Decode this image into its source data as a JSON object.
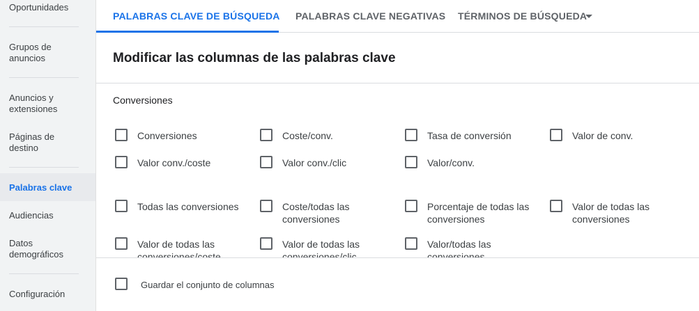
{
  "sidebar": {
    "items": [
      {
        "label": "Oportunidades"
      },
      {
        "label": "Grupos de anuncios"
      },
      {
        "label": "Anuncios y extensiones"
      },
      {
        "label": "Páginas de destino"
      },
      {
        "label": "Palabras clave"
      },
      {
        "label": "Audiencias"
      },
      {
        "label": "Datos demográficos"
      },
      {
        "label": "Configuración"
      }
    ],
    "active_item": "Palabras clave"
  },
  "tabs": [
    {
      "label": "PALABRAS CLAVE DE BÚSQUEDA",
      "active": true
    },
    {
      "label": "PALABRAS CLAVE NEGATIVAS",
      "active": false
    },
    {
      "label": "TÉRMINOS DE BÚSQUEDA",
      "active": false
    }
  ],
  "panel": {
    "title": "Modificar las columnas de las palabras clave",
    "section_title": "Conversiones",
    "options": [
      {
        "label": "Conversiones",
        "checked": false
      },
      {
        "label": "Coste/conv.",
        "checked": false
      },
      {
        "label": "Tasa de conversión",
        "checked": false
      },
      {
        "label": "Valor de conv.",
        "checked": false
      },
      {
        "label": "Valor conv./coste",
        "checked": false
      },
      {
        "label": "Valor conv./clic",
        "checked": false
      },
      {
        "label": "Valor/conv.",
        "checked": false
      },
      {
        "label": "Todas las conversiones",
        "checked": false
      },
      {
        "label": "Coste/todas las conversiones",
        "checked": false
      },
      {
        "label": "Porcentaje de todas las conversiones",
        "checked": false
      },
      {
        "label": "Valor de todas las conversiones",
        "checked": false
      },
      {
        "label": "Valor de todas las conversiones/coste",
        "checked": false
      },
      {
        "label": "Valor de todas las conversiones/clic",
        "checked": false
      },
      {
        "label": "Valor/todas las conversiones",
        "checked": false
      }
    ],
    "save_set_label": "Guardar el conjunto de columnas"
  },
  "colors": {
    "accent": "#1a73e8",
    "sidebar_bg": "#f1f3f4",
    "active_bg": "#e8eaed"
  }
}
